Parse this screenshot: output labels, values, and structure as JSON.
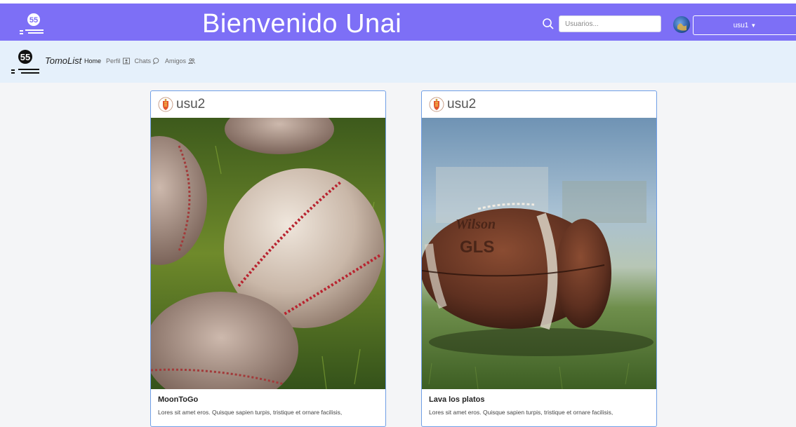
{
  "header": {
    "welcome": "Bienvenido Unai",
    "search": {
      "placeholder": "Usuarios..."
    },
    "user_button": "usu1",
    "colors": {
      "background": "#7d6ff6",
      "text": "#ffffff"
    }
  },
  "nav": {
    "brand": "TomoList",
    "links": [
      {
        "label": "Home",
        "icon": ""
      },
      {
        "label": "Perfil",
        "icon": "profile-card-icon"
      },
      {
        "label": "Chats",
        "icon": "chat-bubble-icon"
      },
      {
        "label": "Amigos",
        "icon": "friends-icon"
      }
    ],
    "background": "#e5f0fb"
  },
  "posts": [
    {
      "user": "usu2",
      "image": "baseballs-on-grass",
      "title": "MoonToGo",
      "text": "Lores sit amet eros. Quisque sapien turpis, tristique et ornare facilisis,"
    },
    {
      "user": "usu2",
      "image": "american-football-on-field",
      "title": "Lava los platos",
      "text": "Lores sit amet eros. Quisque sapien turpis, tristique et ornare facilisis,"
    }
  ]
}
